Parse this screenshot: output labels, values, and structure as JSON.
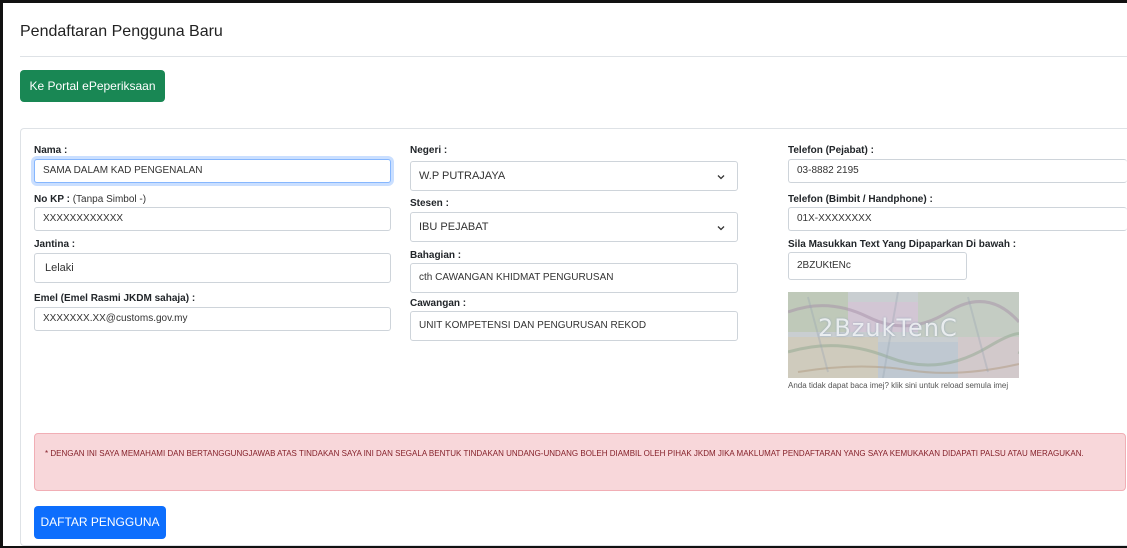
{
  "page": {
    "title": "Pendaftaran Pengguna Baru"
  },
  "portal_button": {
    "label": "Ke Portal ePeperiksaan"
  },
  "form": {
    "nama": {
      "label": "Nama :",
      "value": "SAMA DALAM KAD PENGENALAN"
    },
    "nokp": {
      "label": "No KP :",
      "hint": "(Tanpa Simbol -)",
      "value": "XXXXXXXXXXXX"
    },
    "jantina": {
      "label": "Jantina :",
      "value": "Lelaki"
    },
    "emel": {
      "label": "Emel (Emel Rasmi JKDM sahaja) :",
      "value": "XXXXXXX.XX@customs.gov.my"
    },
    "negeri": {
      "label": "Negeri :",
      "value": "W.P PUTRAJAYA"
    },
    "stesen": {
      "label": "Stesen :",
      "value": "IBU PEJABAT"
    },
    "bahagian": {
      "label": "Bahagian :",
      "value": "cth  CAWANGAN KHIDMAT PENGURUSAN"
    },
    "cawangan": {
      "label": "Cawangan :",
      "value": "UNIT KOMPETENSI DAN PENGURUSAN REKOD"
    },
    "telefon_pejabat": {
      "label": "Telefon (Pejabat) :",
      "value": "03-8882 2195"
    },
    "telefon_bimbit": {
      "label": "Telefon (Bimbit / Handphone) :",
      "value": "01X-XXXXXXXX"
    },
    "captcha_input": {
      "label": "Sila Masukkan Text Yang Dipaparkan Di bawah :",
      "value": "2BZUKtENc"
    },
    "captcha_image_text": "2BzukTenC",
    "captcha_reload_note": "Anda tidak dapat baca imej? klik sini untuk reload semula imej"
  },
  "declaration": "* DENGAN INI SAYA MEMAHAMI DAN BERTANGGUNGJAWAB ATAS TINDAKAN SAYA INI DAN SEGALA BENTUK TINDAKAN UNDANG-UNDANG BOLEH DIAMBIL OLEH PIHAK JKDM JIKA MAKLUMAT PENDAFTARAN YANG SAYA KEMUKAKAN DIDAPATI PALSU ATAU MERAGUKAN.",
  "submit_button": {
    "label": "DAFTAR PENGGUNA"
  },
  "colors": {
    "success": "#198754",
    "primary": "#0d6efd",
    "alert_bg": "#f8d7da",
    "alert_text": "#842029"
  },
  "icons": {
    "select_arrow": "chevron-down-icon"
  }
}
